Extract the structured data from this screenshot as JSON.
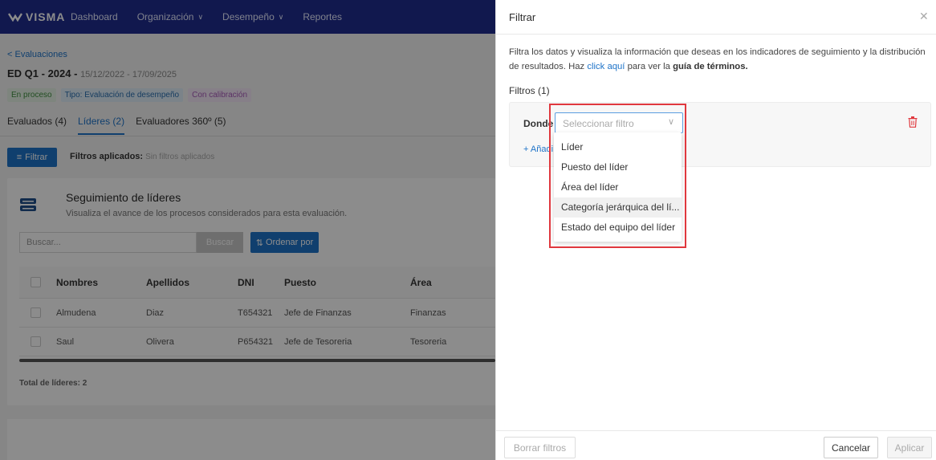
{
  "topbar": {
    "brand": "VISMA",
    "nav": [
      {
        "label": "Dashboard",
        "chevron": false
      },
      {
        "label": "Organización",
        "chevron": true
      },
      {
        "label": "Desempeño",
        "chevron": true
      },
      {
        "label": "Reportes",
        "chevron": false
      }
    ]
  },
  "page": {
    "back_link": "< Evaluaciones",
    "title": "ED Q1 - 2024",
    "title_sep": " - ",
    "dates": "15/12/2022 - 17/09/2025",
    "badges": [
      "En proceso",
      "Tipo: Evaluación de desempeño",
      "Con calibración"
    ],
    "tabs": [
      "Evaluados (4)",
      "Líderes (2)",
      "Evaluadores 360º (5)"
    ],
    "filter_button": "Filtrar",
    "applied_label": "Filtros aplicados:",
    "applied_value": "Sin filtros aplicados"
  },
  "card": {
    "title": "Seguimiento de líderes",
    "subtitle": "Visualiza el avance de los procesos considerados para esta evaluación.",
    "search_placeholder": "Buscar...",
    "search_button": "Buscar",
    "order_button": "Ordenar por",
    "columns": [
      "Nombres",
      "Apellidos",
      "DNI",
      "Puesto",
      "Área"
    ],
    "rows": [
      [
        "Almudena",
        "Diaz",
        "T654321",
        "Jefe de Finanzas",
        "Finanzas"
      ],
      [
        "Saul",
        "Olivera",
        "P654321",
        "Jefe de Tesoreria",
        "Tesoreria"
      ]
    ],
    "total": "Total de líderes: 2"
  },
  "panel": {
    "title": "Filtrar",
    "description_start": "Filtra los datos y visualiza la información que deseas en los indicadores de seguimiento y la distribución de resultados. Haz ",
    "description_link": "click aquí",
    "description_mid": " para ver la ",
    "description_bold": "guía de términos.",
    "filters_count": "Filtros (1)",
    "where_label": "Donde",
    "select_placeholder": "Seleccionar filtro",
    "add_link": "+ Añadi",
    "options": [
      "Líder",
      "Puesto del líder",
      "Área del líder",
      "Categoría jerárquica del lí...",
      "Estado del equipo del líder"
    ],
    "highlighted_option": 3,
    "buttons": {
      "clear": "Borrar filtros",
      "cancel": "Cancelar",
      "apply": "Aplicar"
    }
  },
  "colors": {
    "primary": "#1e73c8",
    "topbar": "#1f2d8f",
    "highlight_border": "#e0383e",
    "delete": "#e0383e"
  }
}
